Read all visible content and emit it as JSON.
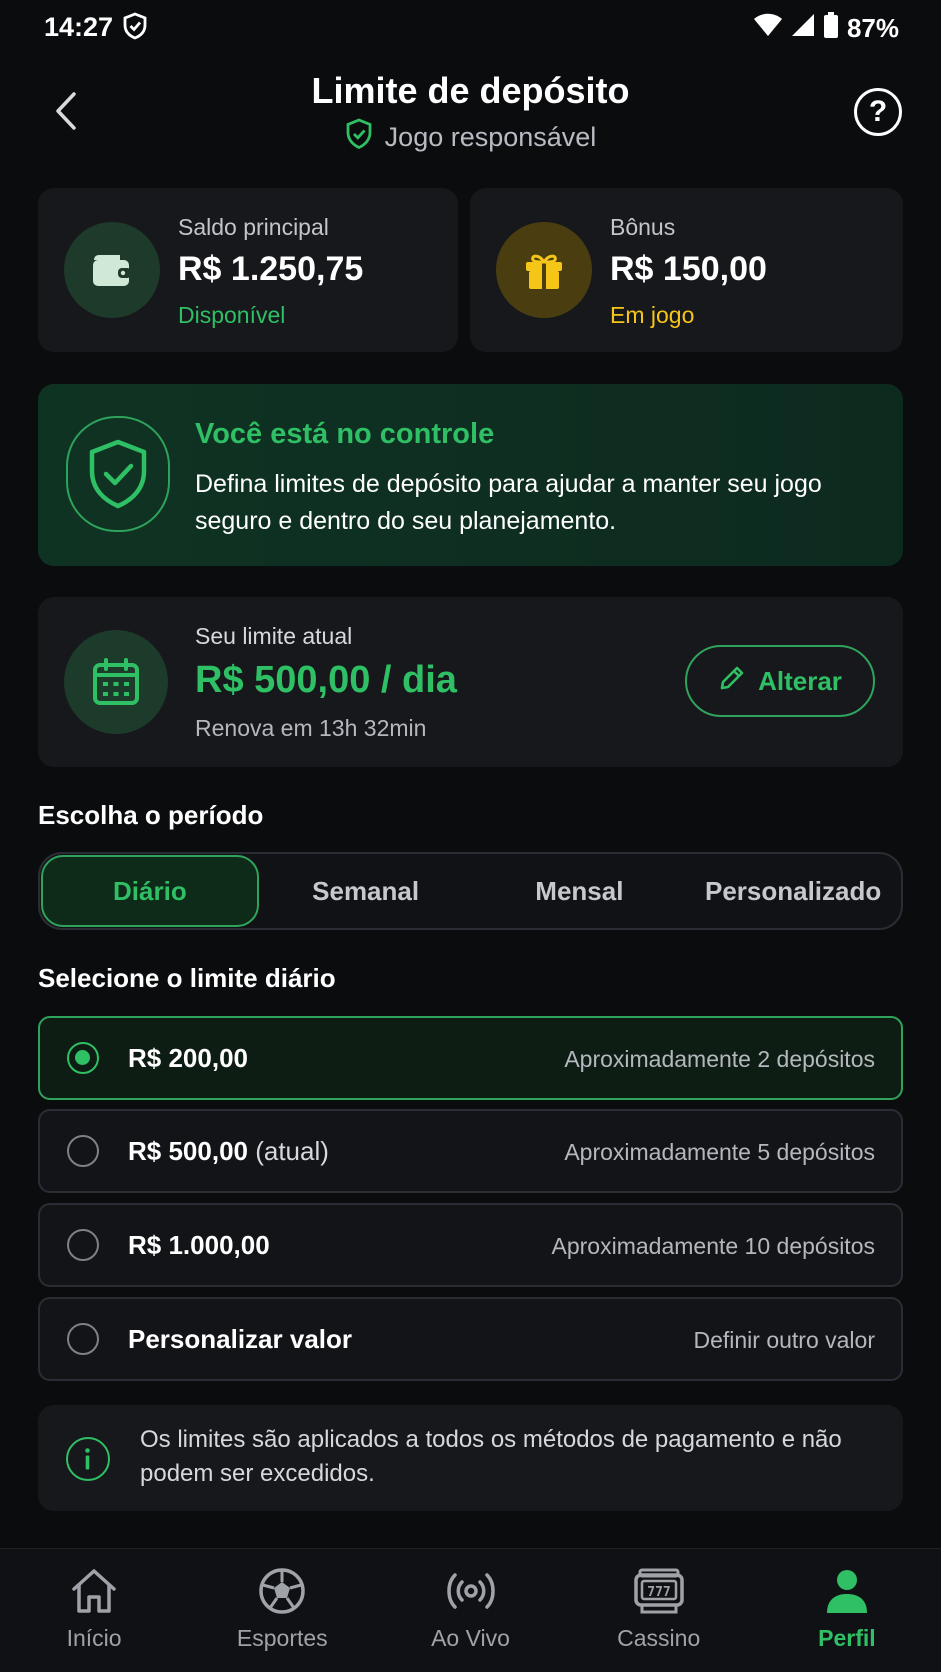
{
  "status_bar": {
    "time": "14:27",
    "battery": "87%"
  },
  "header": {
    "title": "Limite de depósito",
    "subtitle": "Jogo responsável"
  },
  "balances": [
    {
      "label": "Saldo principal",
      "value": "R$ 1.250,75",
      "status": "Disponível",
      "status_color": "#2fbf64",
      "icon": "wallet-icon"
    },
    {
      "label": "Bônus",
      "value": "R$ 150,00",
      "status": "Em jogo",
      "status_color": "#f5c518",
      "icon": "gift-icon"
    }
  ],
  "control_banner": {
    "title": "Você está no controle",
    "text": "Defina limites de depósito para ajudar a manter seu jogo seguro e dentro do seu planejamento."
  },
  "current_limit": {
    "label": "Seu limite atual",
    "value": "R$ 500,00 / dia",
    "renew": "Renova em 13h 32min",
    "edit_label": "Alterar"
  },
  "period": {
    "title": "Escolha o período",
    "tabs": [
      "Diário",
      "Semanal",
      "Mensal",
      "Personalizado"
    ],
    "active_index": 0
  },
  "limit_options": {
    "title": "Selecione o limite diário",
    "items": [
      {
        "label": "R$ 200,00",
        "suffix": "",
        "desc": "Aproximadamente 2 depósitos",
        "selected": true
      },
      {
        "label": "R$ 500,00",
        "suffix": "(atual)",
        "desc": "Aproximadamente 5 depósitos",
        "selected": false
      },
      {
        "label": "R$ 1.000,00",
        "suffix": "",
        "desc": "Aproximadamente 10 depósitos",
        "selected": false
      },
      {
        "label": "Personalizar valor",
        "suffix": "",
        "desc": "Definir outro valor",
        "selected": false
      }
    ]
  },
  "info_note": "Os limites são aplicados a todos os métodos de pagamento e não podem ser excedidos.",
  "bottom_nav": [
    {
      "label": "Início",
      "icon": "home-icon",
      "active": false
    },
    {
      "label": "Esportes",
      "icon": "soccer-ball-icon",
      "active": false
    },
    {
      "label": "Ao Vivo",
      "icon": "broadcast-icon",
      "active": false
    },
    {
      "label": "Cassino",
      "icon": "slot-machine-icon",
      "active": false
    },
    {
      "label": "Perfil",
      "icon": "user-icon",
      "active": true
    }
  ],
  "colors": {
    "accent": "#2fbf64",
    "gold": "#f5c518",
    "background": "#0b0c0e",
    "card": "#16181c"
  }
}
